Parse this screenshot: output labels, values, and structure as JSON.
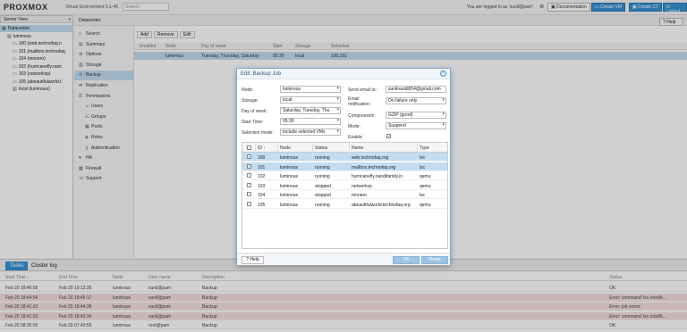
{
  "topbar": {
    "logo_text": "PROXMOX",
    "version": "Virtual Environment 5.1-46",
    "search_placeholder": "Search",
    "logged_in": "You are logged in as 'sunil@pam'",
    "docs_label": "Documentation",
    "create_vm_label": "Create VM",
    "create_ct_label": "Create CT",
    "logout_label": "Logout"
  },
  "serverview": {
    "label": "Server View"
  },
  "tree": {
    "items": [
      {
        "label": "Datacenter",
        "icon": "datacenter-icon"
      },
      {
        "label": "luminous",
        "icon": "node-icon"
      },
      {
        "label": "100 (web.technofaq.o",
        "icon": "vm-icon"
      },
      {
        "label": "101 (mailbox.technofaq.",
        "icon": "vm-icon"
      },
      {
        "label": "104 (monero)",
        "icon": "vm-icon"
      },
      {
        "label": "102 (hurricanefly.num",
        "icon": "vm-icon"
      },
      {
        "label": "103 (networkxp)",
        "icon": "vm-icon"
      },
      {
        "label": "105 (abeautifulworld.t",
        "icon": "vm-icon"
      },
      {
        "label": "local (luminous)",
        "icon": "storage-icon"
      }
    ]
  },
  "nav": {
    "header": "Datacenter",
    "items": [
      {
        "label": "Search",
        "icon": "search-icon",
        "sub": false
      },
      {
        "label": "Summary",
        "icon": "summary-icon",
        "sub": false
      },
      {
        "label": "Options",
        "icon": "gear-icon",
        "sub": false
      },
      {
        "label": "Storage",
        "icon": "storage-icon",
        "sub": false
      },
      {
        "label": "Backup",
        "icon": "backup-icon",
        "sub": false
      },
      {
        "label": "Replication",
        "icon": "replication-icon",
        "sub": false
      },
      {
        "label": "Permissions",
        "icon": "permissions-icon",
        "sub": false
      },
      {
        "label": "Users",
        "icon": "user-icon",
        "sub": true
      },
      {
        "label": "Groups",
        "icon": "group-icon",
        "sub": true
      },
      {
        "label": "Pools",
        "icon": "pool-icon",
        "sub": true
      },
      {
        "label": "Roles",
        "icon": "role-icon",
        "sub": true
      },
      {
        "label": "Authentication",
        "icon": "key-icon",
        "sub": true
      },
      {
        "label": "HA",
        "icon": "ha-icon",
        "sub": false
      },
      {
        "label": "Firewall",
        "icon": "firewall-icon",
        "sub": false
      },
      {
        "label": "Support",
        "icon": "support-icon",
        "sub": false
      }
    ]
  },
  "main": {
    "add_label": "Add",
    "remove_label": "Remove",
    "edit_label": "Edit",
    "help_label": "Help",
    "columns": [
      "Enabled",
      "Node",
      "Day of week",
      "Start",
      "Storage",
      "Selection"
    ],
    "row": [
      "",
      "luminous",
      "Tuesday, Thursday, Saturday",
      "05:30",
      "local",
      "100,101"
    ]
  },
  "modal": {
    "title": "Edit: Backup Job",
    "node_label": "Node:",
    "node_value": "luminous",
    "storage_label": "Storage:",
    "storage_value": "local",
    "dow_label": "Day of week:",
    "dow_value": "Saturday, Tuesday, Thu",
    "start_label": "Start Time:",
    "start_value": "05:30",
    "selection_label": "Selection mode:",
    "selection_value": "Include selected VMs",
    "email_label": "Send email to:",
    "email_value": "sunilnandi834@gmail.com",
    "notify_label1": "Email",
    "notify_label2": "notification:",
    "notify_value": "On failure only",
    "compression_label": "Compression:",
    "compression_value": "GZIP (good)",
    "mode_label": "Mode:",
    "mode_value": "Suspend",
    "enable_label": "Enable:",
    "columns": [
      "ID ↑",
      "Node",
      "Status",
      "Name",
      "Type"
    ],
    "vms": [
      {
        "id": "100",
        "node": "luminous",
        "status": "running",
        "name": "web.technofaq.org",
        "type": "lxc",
        "selected": true
      },
      {
        "id": "101",
        "node": "luminous",
        "status": "running",
        "name": "mailbox.technofaq.org",
        "type": "lxc",
        "selected": true
      },
      {
        "id": "102",
        "node": "luminous",
        "status": "running",
        "name": "hurricanefly.nandifamily.in",
        "type": "qemu",
        "selected": false
      },
      {
        "id": "103",
        "node": "luminous",
        "status": "stopped",
        "name": "networkxp",
        "type": "qemu",
        "selected": false
      },
      {
        "id": "104",
        "node": "luminous",
        "status": "stopped",
        "name": "monero",
        "type": "lxc",
        "selected": false
      },
      {
        "id": "105",
        "node": "luminous",
        "status": "running",
        "name": "abeautifulworld.technofaq.org",
        "type": "qemu",
        "selected": false
      }
    ],
    "help_label": "Help",
    "ok_label": "OK",
    "reset_label": "Reset"
  },
  "bottom": {
    "tabs": [
      "Tasks",
      "Cluster log"
    ],
    "columns": [
      "Start Time ↓",
      "End Time",
      "Node",
      "User name",
      "Description",
      "Status"
    ],
    "rows": [
      {
        "start": "Feb 20 18:45:56",
        "end": "Feb 20 19:12:39",
        "node": "luminous",
        "user": "sunil@pam",
        "desc": "Backup",
        "status": "OK",
        "err": false
      },
      {
        "start": "Feb 20 18:44:54",
        "end": "Feb 20 18:45:17",
        "node": "luminous",
        "user": "sunil@pam",
        "desc": "Backup",
        "status": "Error: command 'lxc-lock/lk...",
        "err": true
      },
      {
        "start": "Feb 20 18:41:23",
        "end": "Feb 20 18:44:38",
        "node": "luminous",
        "user": "sunil@pam",
        "desc": "Backup",
        "status": "Error: job errors",
        "err": true
      },
      {
        "start": "Feb 20 18:41:23",
        "end": "Feb 20 18:42:34",
        "node": "luminous",
        "user": "sunil@pam",
        "desc": "Backup",
        "status": "Error: command 'lxc-lock/lk...",
        "err": true
      },
      {
        "start": "Feb 20 08:30:03",
        "end": "Feb 20 07:43:55",
        "node": "luminous",
        "user": "root@pam",
        "desc": "Backup",
        "status": "OK",
        "err": false
      }
    ]
  }
}
